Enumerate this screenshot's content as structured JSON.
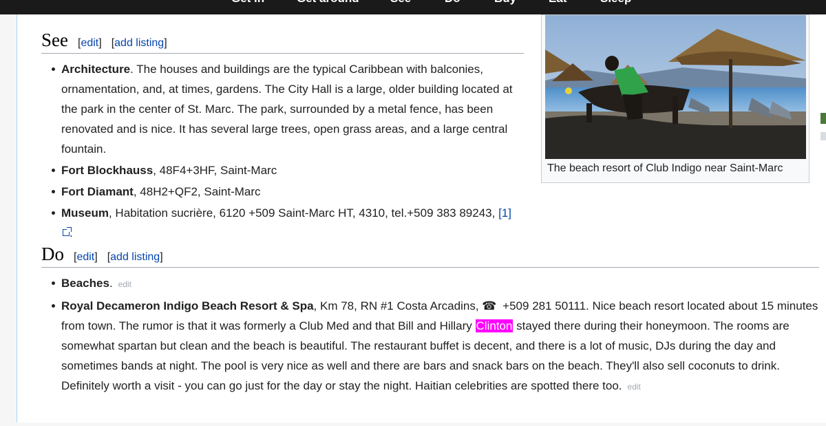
{
  "top_tabs": [
    "Get in",
    "Get around",
    "See",
    "Do",
    "Buy",
    "Eat",
    "Sleep"
  ],
  "see": {
    "heading": "See",
    "edit_label": "edit",
    "add_listing_label": "add listing",
    "items": [
      {
        "name": "Architecture",
        "text": ". The houses and buildings are the typical Caribbean with balconies, ornamentation, and, at times, gardens. The City Hall is a large, older building located at the park in the center of St. Marc. The park, surrounded by a metal fence, has been renovated and is nice. It has several large trees, open grass areas, and a large central fountain."
      },
      {
        "name": "Fort Blockhauss",
        "text": ", 48F4+3HF, Saint-Marc"
      },
      {
        "name": "Fort Diamant",
        "text": ", 48H2+QF2, Saint-Marc"
      },
      {
        "name": "Museum",
        "text": ", Habitation sucrière, 6120 +509 Saint-Marc HT, 4310, tel.+509 383 89243, ",
        "link": "[1]",
        "tail": "."
      }
    ]
  },
  "do": {
    "heading": "Do",
    "edit_label": "edit",
    "add_listing_label": "add listing",
    "items": [
      {
        "name": "Beaches",
        "text": ".",
        "small_edit": "edit"
      },
      {
        "name": "Royal Decameron Indigo Beach Resort & Spa",
        "text_a": ", Km 78, RN #1 Costa Arcadins, ",
        "phone_icon": "☎",
        "text_b": " +509 281 50111. Nice beach resort located about 15 minutes from town. The rumor is that it was formerly a Club Med and that Bill and Hillary ",
        "highlight": "Clinton",
        "text_c": " stayed there during their honeymoon. The rooms are somewhat spartan but clean and the beach is beautiful. The restaurant buffet is decent, and there is a lot of music, DJs during the day and sometimes bands at night. The pool is very nice as well and there are bars and snack bars on the beach. They'll also sell coconuts to drink. Definitely worth a visit - you can go just for the day or stay the night. Haitian celebrities are spotted there too.",
        "small_edit": "edit"
      }
    ]
  },
  "thumbnail": {
    "caption": "The beach resort of Club Indigo near Saint-Marc"
  },
  "colors": {
    "link": "#0645ad",
    "highlight": "#ff00ff",
    "topbar": "#1a1a1a"
  }
}
